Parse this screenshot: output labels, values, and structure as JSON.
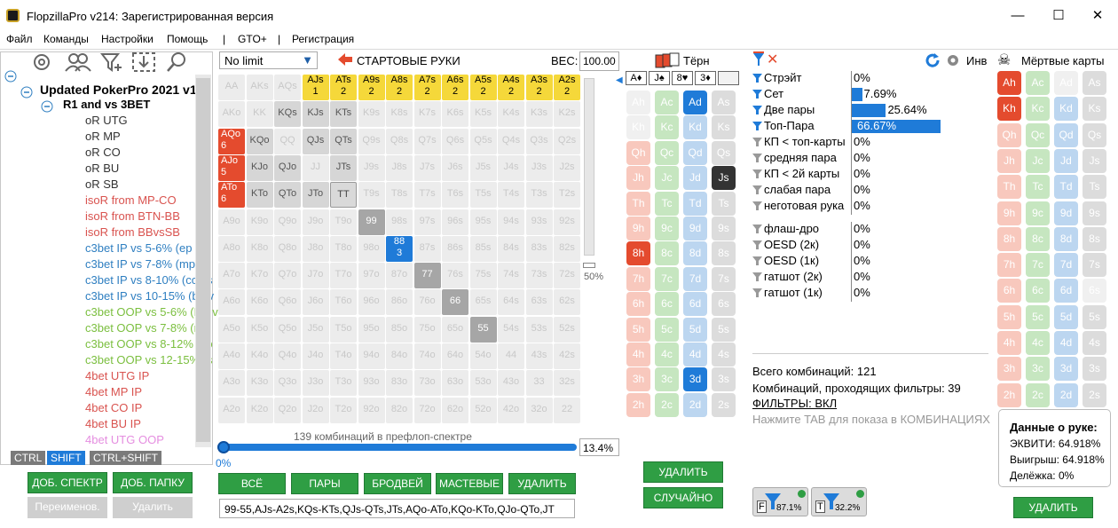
{
  "window": {
    "title": "FlopzillaPro v214: Зарегистрированная версия",
    "min": "—",
    "max": "☐",
    "close": "✕"
  },
  "menu": [
    "Файл",
    "Команды",
    "Настройки",
    "Помощь",
    "|",
    "GTO+",
    "|",
    "Регистрация"
  ],
  "tree": {
    "root": "Updated PokerPro 2021 v1.2",
    "folder": "R1 and vs 3BET",
    "items": [
      {
        "label": "oR UTG",
        "color": "gray"
      },
      {
        "label": "oR MP",
        "color": "gray"
      },
      {
        "label": "oR CO",
        "color": "gray"
      },
      {
        "label": "oR BU",
        "color": "gray"
      },
      {
        "label": "oR SB",
        "color": "gray"
      },
      {
        "label": "isoR from MP-CO",
        "color": "red"
      },
      {
        "label": "isoR from BTN-BB",
        "color": "red"
      },
      {
        "label": "isoR from BBvsSB",
        "color": "red"
      },
      {
        "label": "c3bet IP vs 5-6% (ep vs",
        "color": "blue"
      },
      {
        "label": "c3bet IP vs 7-8% (mp vs",
        "color": "blue"
      },
      {
        "label": "c3bet IP vs 8-10% (co vs",
        "color": "blue"
      },
      {
        "label": "c3bet IP vs 10-15% (bu v",
        "color": "blue"
      },
      {
        "label": "c3bet OOP vs 5-6% (EP v",
        "color": "green"
      },
      {
        "label": "c3bet OOP vs 7-8% (mp",
        "color": "green"
      },
      {
        "label": "c3bet OOP vs 8-12% (co",
        "color": "green"
      },
      {
        "label": "c3bet OOP vs 12-15% (s",
        "color": "green"
      },
      {
        "label": "4bet UTG IP",
        "color": "red"
      },
      {
        "label": "4bet MP IP",
        "color": "red"
      },
      {
        "label": "4bet CO IP",
        "color": "red"
      },
      {
        "label": "4bet BU IP",
        "color": "red"
      },
      {
        "label": "4bet UTG OOP",
        "color": "pink"
      }
    ]
  },
  "keys": [
    "CTRL",
    "SHIFT",
    "CTRL+SHIFT"
  ],
  "left_buttons": {
    "add_range": "ДОБ. СПЕКТР",
    "add_folder": "ДОБ. ПАПКУ",
    "rename": "Переименов.",
    "delete": "Удалить"
  },
  "range": {
    "limit": "No limit",
    "start_hands": "СТАРТОВЫЕ РУКИ",
    "weight_label": "ВЕС:",
    "weight": "100.00",
    "scroll_pct": "50%",
    "combos_text": "139 комбинаций в префлоп-спектре",
    "progress_pct": "0%",
    "percent": "13.4%",
    "buttons": [
      "ВСЁ",
      "ПАРЫ",
      "БРОДВЕЙ",
      "МАСТЕВЫЕ",
      "УДАЛИТЬ"
    ],
    "text": "99-55,AJs-A2s,KQs-KTs,QJs-QTs,JTs,AQo-ATo,KQo-KTo,QJo-QTo,JT"
  },
  "grid": [
    [
      "AA",
      "AKs",
      "AQs",
      "AJs",
      "ATs",
      "A9s",
      "A8s",
      "A7s",
      "A6s",
      "A5s",
      "A4s",
      "A3s",
      "A2s"
    ],
    [
      "AKo",
      "KK",
      "KQs",
      "KJs",
      "KTs",
      "K9s",
      "K8s",
      "K7s",
      "K6s",
      "K5s",
      "K4s",
      "K3s",
      "K2s"
    ],
    [
      "AQo",
      "KQo",
      "QQ",
      "QJs",
      "QTs",
      "Q9s",
      "Q8s",
      "Q7s",
      "Q6s",
      "Q5s",
      "Q4s",
      "Q3s",
      "Q2s"
    ],
    [
      "AJo",
      "KJo",
      "QJo",
      "JJ",
      "JTs",
      "J9s",
      "J8s",
      "J7s",
      "J6s",
      "J5s",
      "J4s",
      "J3s",
      "J2s"
    ],
    [
      "ATo",
      "KTo",
      "QTo",
      "JTo",
      "TT",
      "T9s",
      "T8s",
      "T7s",
      "T6s",
      "T5s",
      "T4s",
      "T3s",
      "T2s"
    ],
    [
      "A9o",
      "K9o",
      "Q9o",
      "J9o",
      "T9o",
      "99",
      "98s",
      "97s",
      "96s",
      "95s",
      "94s",
      "93s",
      "92s"
    ],
    [
      "A8o",
      "K8o",
      "Q8o",
      "J8o",
      "T8o",
      "98o",
      "88",
      "87s",
      "86s",
      "85s",
      "84s",
      "83s",
      "82s"
    ],
    [
      "A7o",
      "K7o",
      "Q7o",
      "J7o",
      "T7o",
      "97o",
      "87o",
      "77",
      "76s",
      "75s",
      "74s",
      "73s",
      "72s"
    ],
    [
      "A6o",
      "K6o",
      "Q6o",
      "J6o",
      "T6o",
      "96o",
      "86o",
      "76o",
      "66",
      "65s",
      "64s",
      "63s",
      "62s"
    ],
    [
      "A5o",
      "K5o",
      "Q5o",
      "J5o",
      "T5o",
      "95o",
      "85o",
      "75o",
      "65o",
      "55",
      "54s",
      "53s",
      "52s"
    ],
    [
      "A4o",
      "K4o",
      "Q4o",
      "J4o",
      "T4o",
      "94o",
      "84o",
      "74o",
      "64o",
      "54o",
      "44",
      "43s",
      "42s"
    ],
    [
      "A3o",
      "K3o",
      "Q3o",
      "J3o",
      "T3o",
      "93o",
      "83o",
      "73o",
      "63o",
      "53o",
      "43o",
      "33",
      "32s"
    ],
    [
      "A2o",
      "K2o",
      "Q2o",
      "J2o",
      "T2o",
      "92o",
      "82o",
      "72o",
      "62o",
      "52o",
      "42o",
      "32o",
      "22"
    ]
  ],
  "grid_counts": {
    "AJs": "1",
    "ATs": "2",
    "A9s": "2",
    "A8s": "2",
    "A7s": "2",
    "A6s": "2",
    "A5s": "2",
    "A4s": "2",
    "A3s": "2",
    "A2s": "2",
    "AQo": "6",
    "AJo": "5",
    "ATo": "6",
    "88": "3"
  },
  "turn": {
    "label": "Тёрн",
    "board": [
      "A♦",
      "J♠",
      "8♥",
      "3♦"
    ],
    "delete": "УДАЛИТЬ",
    "random": "СЛУЧАЙНО"
  },
  "stats": {
    "inv": "Инв",
    "rows": [
      {
        "label": "Стрэйт",
        "pct": "0%",
        "val": 0
      },
      {
        "label": "Сет",
        "pct": "7.69%",
        "val": 7.69
      },
      {
        "label": "Две пары",
        "pct": "25.64%",
        "val": 25.64
      },
      {
        "label": "Топ-Пара",
        "pct": "66.67%",
        "val": 66.67
      },
      {
        "label": "КП < топ-карты",
        "pct": "0%",
        "val": 0
      },
      {
        "label": "средняя пара",
        "pct": "0%",
        "val": 0
      },
      {
        "label": "КП < 2й карты",
        "pct": "0%",
        "val": 0
      },
      {
        "label": "слабая пара",
        "pct": "0%",
        "val": 0
      },
      {
        "label": "неготовая рука",
        "pct": "0%",
        "val": 0
      },
      {
        "label": "флаш-дро",
        "pct": "0%",
        "val": 0
      },
      {
        "label": "OESD (2к)",
        "pct": "0%",
        "val": 0
      },
      {
        "label": "OESD (1к)",
        "pct": "0%",
        "val": 0
      },
      {
        "label": "гатшот (2к)",
        "pct": "0%",
        "val": 0
      },
      {
        "label": "гатшот (1к)",
        "pct": "0%",
        "val": 0
      }
    ],
    "total": "Всего комбинаций: 121",
    "passing": "Комбинаций, проходящих фильтры: 39",
    "filters": "ФИЛЬТРЫ: ВКЛ",
    "hint": "Нажмите TAB для показа в КОМБИНАЦИЯХ",
    "f_badge": "F",
    "f_pct": "87.1%",
    "t_badge": "T",
    "t_pct": "32.2%"
  },
  "dead": {
    "title": "Мёртвые карты",
    "info_title": "Данные о руке:",
    "equity": "ЭКВИТИ: 64.918%",
    "win": "Выигрыш: 64.918%",
    "tie": "Делёжка: 0%",
    "delete": "УДАЛИТЬ"
  },
  "ranks": [
    "A",
    "K",
    "Q",
    "J",
    "T",
    "9",
    "8",
    "7",
    "6",
    "5",
    "4",
    "3",
    "2"
  ],
  "suits": [
    "h",
    "c",
    "d",
    "s"
  ]
}
